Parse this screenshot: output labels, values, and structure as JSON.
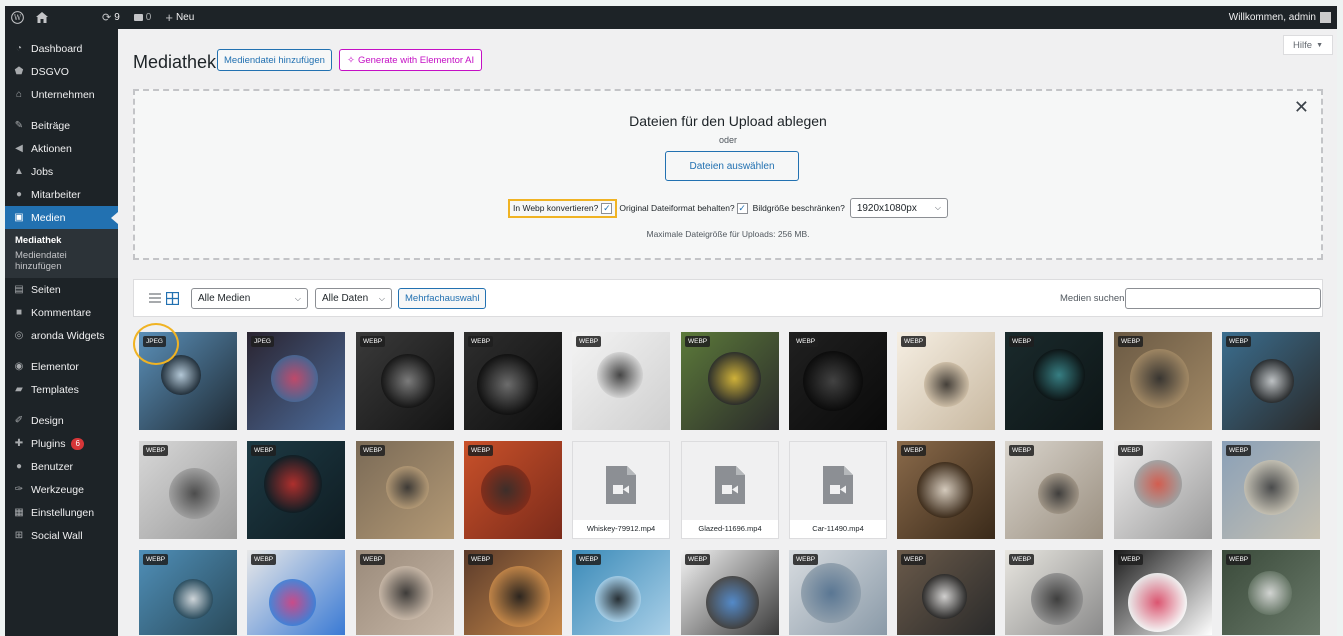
{
  "adminbar": {
    "updates_count": "9",
    "comments_count": "0",
    "new_label": "Neu",
    "welcome": "Willkommen, admin"
  },
  "sidebar": {
    "items": [
      {
        "label": "Dashboard",
        "icon": "dashboard-icon"
      },
      {
        "label": "DSGVO",
        "icon": "shield-icon"
      },
      {
        "label": "Unternehmen",
        "icon": "home-icon"
      },
      {
        "label": "Beiträge",
        "icon": "pin-icon"
      },
      {
        "label": "Aktionen",
        "icon": "megaphone-icon"
      },
      {
        "label": "Jobs",
        "icon": "bell-icon"
      },
      {
        "label": "Mitarbeiter",
        "icon": "users-icon"
      },
      {
        "label": "Medien",
        "icon": "media-icon"
      },
      {
        "label": "Seiten",
        "icon": "page-icon"
      },
      {
        "label": "Kommentare",
        "icon": "comment-icon"
      },
      {
        "label": "aronda Widgets",
        "icon": "widget-icon"
      },
      {
        "label": "Elementor",
        "icon": "elementor-icon"
      },
      {
        "label": "Templates",
        "icon": "folder-icon"
      },
      {
        "label": "Design",
        "icon": "brush-icon"
      },
      {
        "label": "Plugins",
        "icon": "plug-icon",
        "badge": "6"
      },
      {
        "label": "Benutzer",
        "icon": "user-icon"
      },
      {
        "label": "Werkzeuge",
        "icon": "wrench-icon"
      },
      {
        "label": "Einstellungen",
        "icon": "settings-icon"
      },
      {
        "label": "Social Wall",
        "icon": "grid-icon"
      }
    ],
    "submenu": {
      "current": "Mediathek",
      "add_line1": "Mediendatei",
      "add_line2": "hinzufügen"
    }
  },
  "header": {
    "title": "Mediathek",
    "add_button": "Mediendatei hinzufügen",
    "elementor_button": "Generate with Elementor AI",
    "help": "Hilfe"
  },
  "upload": {
    "title": "Dateien für den Upload ablegen",
    "or": "oder",
    "select_button": "Dateien auswählen",
    "webp_label": "In Webp konvertieren?",
    "keep_format_label": "Original Dateiformat behalten?",
    "limit_label": "Bildgröße beschränken?",
    "size_value": "1920x1080px",
    "max_size": "Maximale Dateigröße für Uploads: 256 MB."
  },
  "toolbar": {
    "filter_media": "Alle Medien",
    "filter_dates": "Alle Daten",
    "bulk_select": "Mehrfachauswahl",
    "search_label": "Medien suchen",
    "search_value": ""
  },
  "media": [
    {
      "tag": "JPEG",
      "palette": [
        "#5a8fb8",
        "#c7d9e6",
        "#1f2a33"
      ]
    },
    {
      "tag": "JPEG",
      "palette": [
        "#2a2430",
        "#d64a6b",
        "#4c6b9a"
      ]
    },
    {
      "tag": "WEBP",
      "palette": [
        "#3a3a3a",
        "#8a8a8a",
        "#141414"
      ]
    },
    {
      "tag": "WEBP",
      "palette": [
        "#2e2e2e",
        "#7a7a7a",
        "#0f0f0f"
      ]
    },
    {
      "tag": "WEBP",
      "palette": [
        "#f4f4f4",
        "#2a2a2a",
        "#cfcfcf"
      ]
    },
    {
      "tag": "WEBP",
      "palette": [
        "#5c7a3a",
        "#e8c23a",
        "#2a2a2a"
      ]
    },
    {
      "tag": "WEBP",
      "palette": [
        "#202020",
        "#4a4a4a",
        "#0a0a0a"
      ]
    },
    {
      "tag": "WEBP",
      "palette": [
        "#f6efe3",
        "#2a2622",
        "#c8b8a0"
      ]
    },
    {
      "tag": "WEBP",
      "palette": [
        "#1a2a2c",
        "#3d8f94",
        "#0d1516"
      ]
    },
    {
      "tag": "WEBP",
      "palette": [
        "#6b5a44",
        "#2b2b2b",
        "#a38a66"
      ]
    },
    {
      "tag": "WEBP",
      "palette": [
        "#3b6e8f",
        "#d6d6d6",
        "#2a2a2a"
      ]
    },
    {
      "tag": "WEBP",
      "palette": [
        "#d8d8d8",
        "#3a3a3a",
        "#9a9a9a"
      ]
    },
    {
      "tag": "WEBP",
      "palette": [
        "#1d3a44",
        "#c9302c",
        "#0f1c22"
      ]
    },
    {
      "tag": "WEBP",
      "palette": [
        "#7a6a56",
        "#2e2e2e",
        "#b49a76"
      ]
    },
    {
      "tag": "WEBP",
      "palette": [
        "#c9512a",
        "#2b2b2b",
        "#7a2a1a"
      ]
    },
    {
      "file": "Whiskey-79912.mp4"
    },
    {
      "file": "Glazed-11696.mp4"
    },
    {
      "file": "Car-11490.mp4"
    },
    {
      "tag": "WEBP",
      "palette": [
        "#8a6a4a",
        "#e8e0d4",
        "#3a2a1a"
      ]
    },
    {
      "tag": "WEBP",
      "palette": [
        "#d9d4cc",
        "#2b2b2b",
        "#9a8f80"
      ]
    },
    {
      "tag": "WEBP",
      "palette": [
        "#efeeee",
        "#d44a3a",
        "#9a9a9a"
      ]
    },
    {
      "tag": "WEBP",
      "palette": [
        "#8aa0b8",
        "#3a3a3a",
        "#c6c0b0"
      ]
    },
    {
      "tag": "WEBP",
      "palette": [
        "#4f8fb8",
        "#e8e8e8",
        "#2a4a5a"
      ]
    },
    {
      "tag": "WEBP",
      "palette": [
        "#e8e8e8",
        "#d43a7a",
        "#3a7ad4"
      ]
    },
    {
      "tag": "WEBP",
      "palette": [
        "#9a8a7a",
        "#2a2a2a",
        "#c8b8a8"
      ]
    },
    {
      "tag": "WEBP",
      "palette": [
        "#5a3a2a",
        "#1a1a1a",
        "#c88a4a"
      ]
    },
    {
      "tag": "WEBP",
      "palette": [
        "#3a8ab8",
        "#1a1a1a",
        "#aad0e8"
      ]
    },
    {
      "tag": "WEBP",
      "palette": [
        "#f4f4f4",
        "#4a8ad4",
        "#3a3a3a"
      ]
    },
    {
      "tag": "WEBP",
      "palette": [
        "#d8dce0",
        "#4a6a8a",
        "#8a9aa8"
      ]
    },
    {
      "tag": "WEBP",
      "palette": [
        "#6a5a4a",
        "#e8e8e8",
        "#2a2a2a"
      ]
    },
    {
      "tag": "WEBP",
      "palette": [
        "#e8e6e0",
        "#2a2a2a",
        "#8a8a8a"
      ]
    },
    {
      "tag": "WEBP",
      "palette": [
        "#1a1a1a",
        "#e84a6a",
        "#ffffff"
      ]
    },
    {
      "tag": "WEBP",
      "palette": [
        "#3a4a3a",
        "#e8e8e8",
        "#6a7a6a"
      ]
    }
  ],
  "colors": {
    "accent": "#2271b1",
    "highlight": "#f0b323",
    "elementor": "#c40fc4",
    "adminbar": "#1d2327"
  }
}
